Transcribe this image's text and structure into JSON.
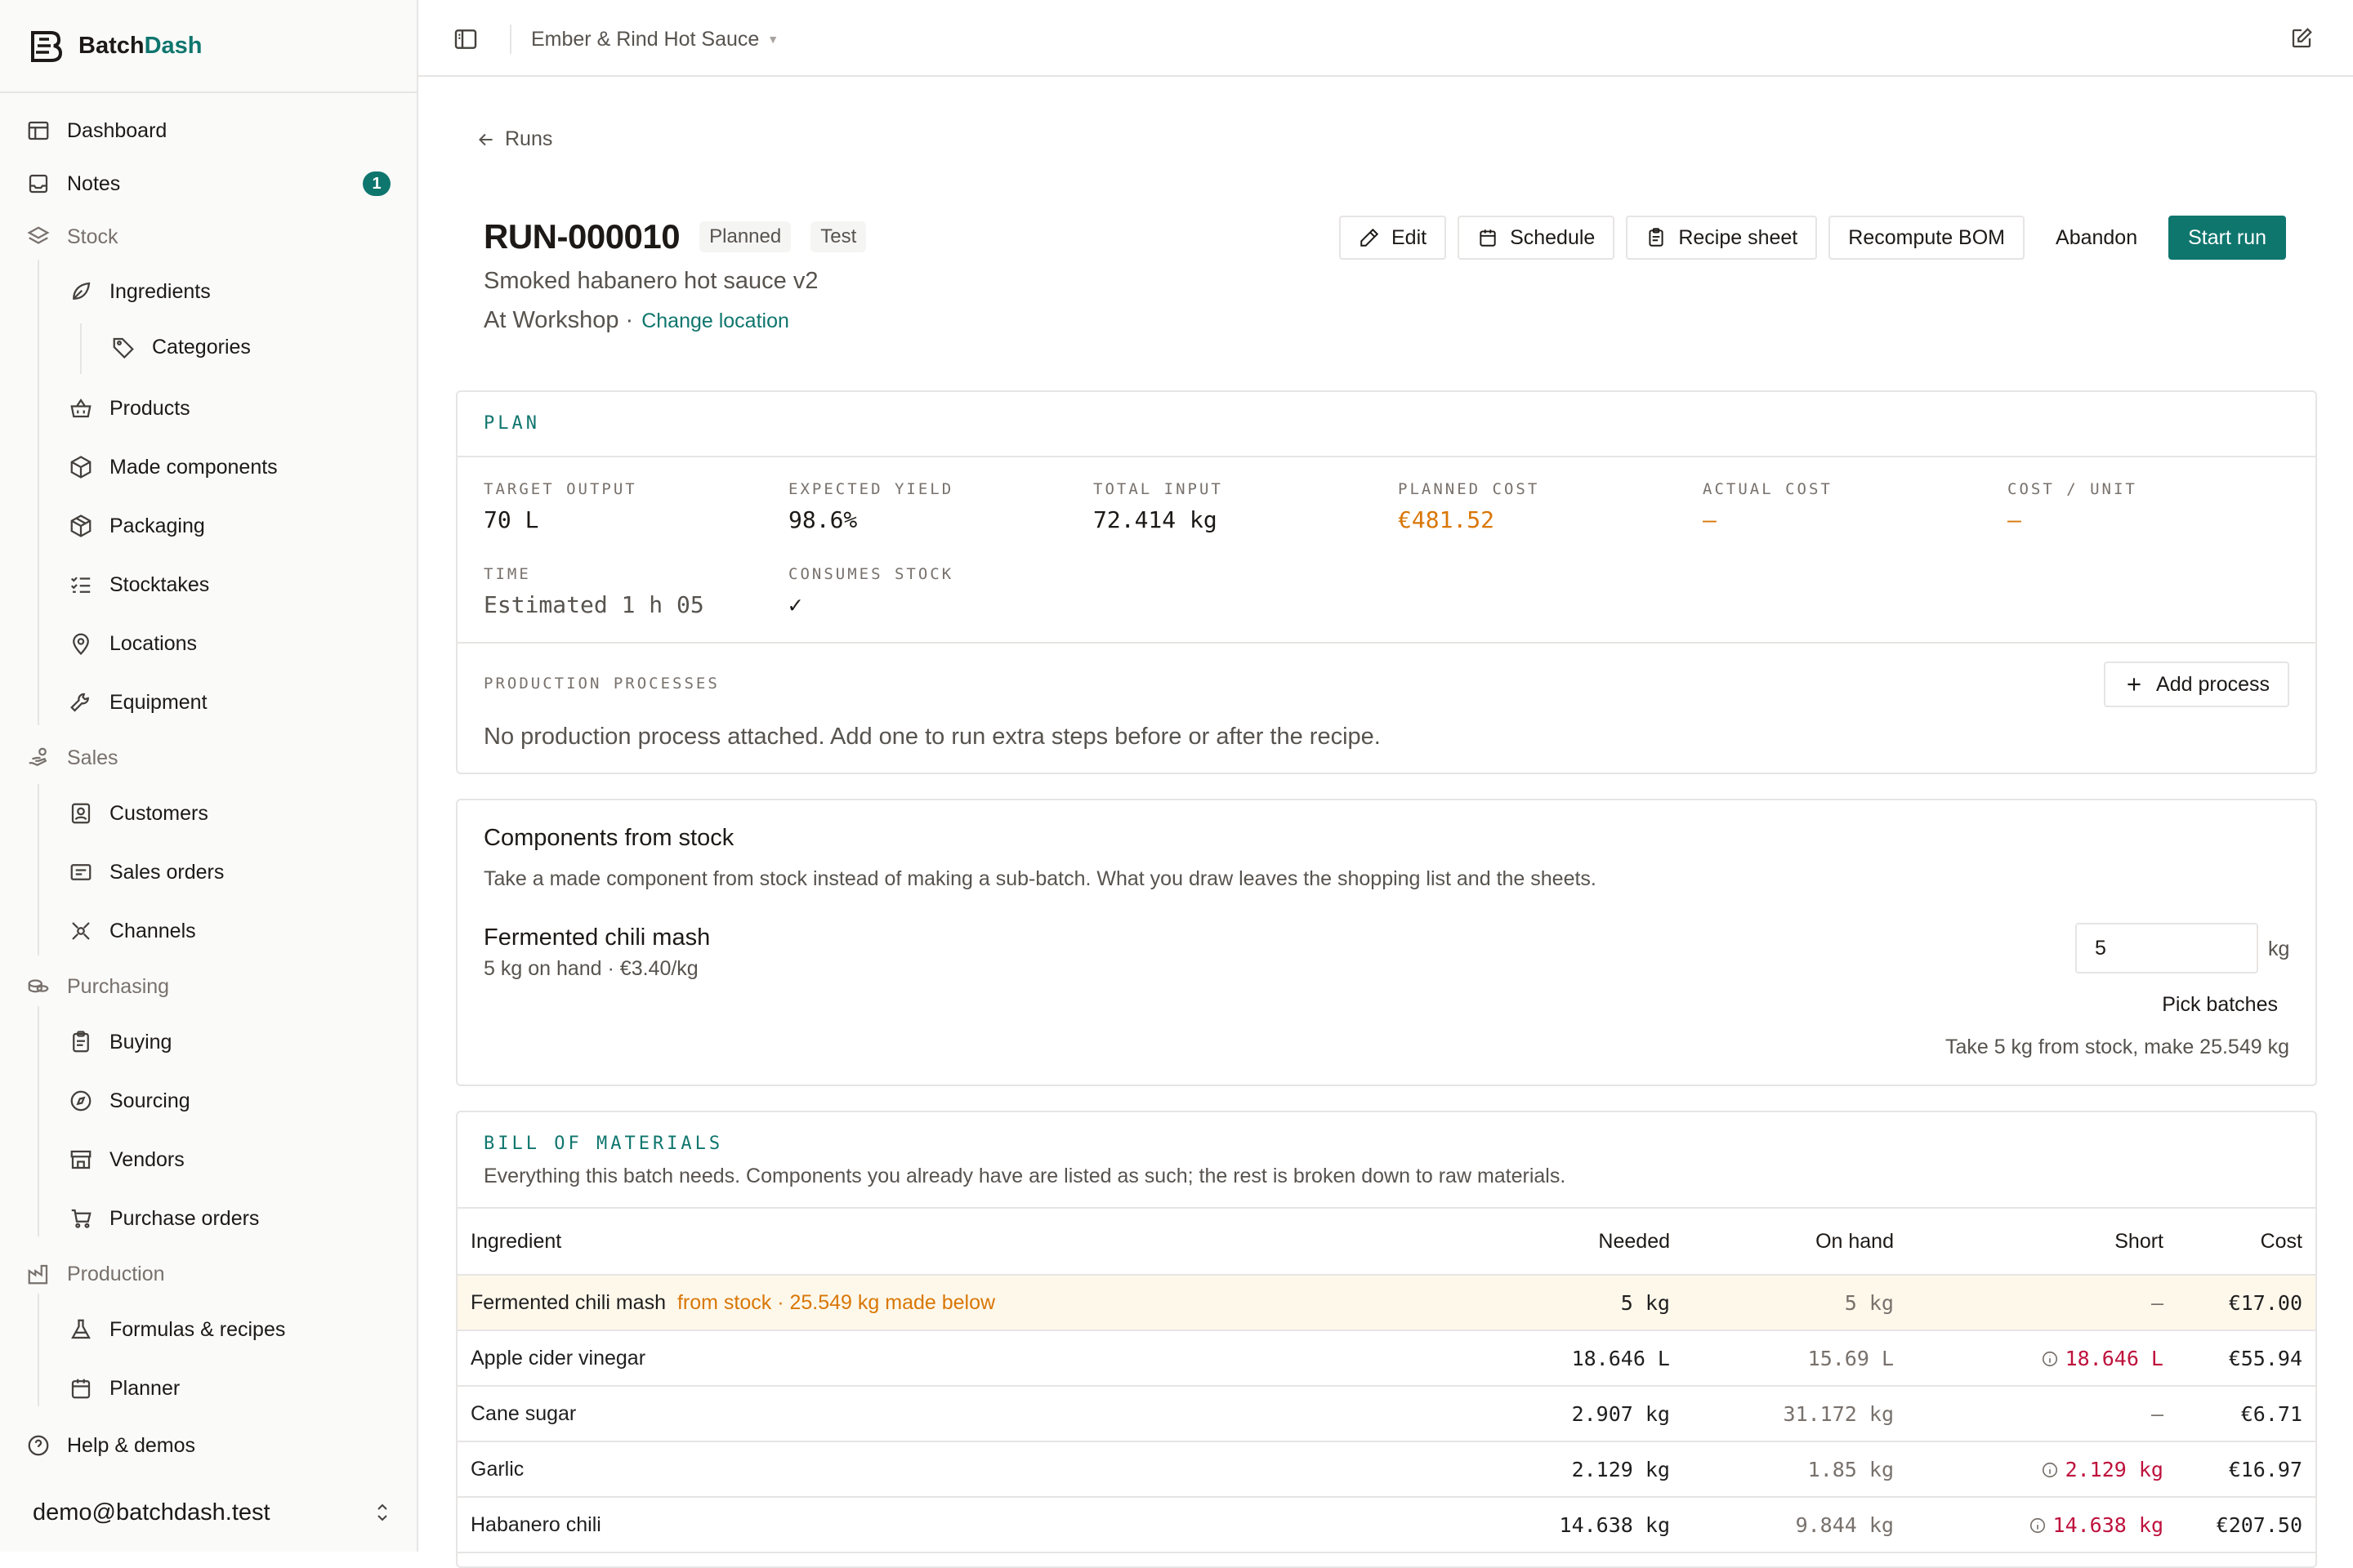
{
  "brand": {
    "name_part1": "Batch",
    "name_part2": "Dash"
  },
  "workspace": {
    "name": "Ember & Rind Hot Sauce"
  },
  "sidebar": {
    "items": [
      {
        "label": "Dashboard",
        "icon": "dashboard-icon"
      },
      {
        "label": "Notes",
        "icon": "inbox-icon",
        "badge": "1"
      },
      {
        "label": "Stock",
        "icon": "layers-icon",
        "group": true
      },
      {
        "label": "Ingredients",
        "icon": "leaf-icon"
      },
      {
        "label": "Categories",
        "icon": "tag-icon"
      },
      {
        "label": "Products",
        "icon": "basket-icon"
      },
      {
        "label": "Made components",
        "icon": "cube-icon"
      },
      {
        "label": "Packaging",
        "icon": "package-icon"
      },
      {
        "label": "Stocktakes",
        "icon": "checklist-icon"
      },
      {
        "label": "Locations",
        "icon": "map-pin-icon"
      },
      {
        "label": "Equipment",
        "icon": "wrench-icon"
      },
      {
        "label": "Sales",
        "icon": "hand-coins-icon",
        "group": true
      },
      {
        "label": "Customers",
        "icon": "contact-icon"
      },
      {
        "label": "Sales orders",
        "icon": "receipt-icon"
      },
      {
        "label": "Channels",
        "icon": "network-icon"
      },
      {
        "label": "Purchasing",
        "icon": "coins-icon",
        "group": true
      },
      {
        "label": "Buying",
        "icon": "clipboard-icon"
      },
      {
        "label": "Sourcing",
        "icon": "compass-icon"
      },
      {
        "label": "Vendors",
        "icon": "store-icon"
      },
      {
        "label": "Purchase orders",
        "icon": "cart-icon"
      },
      {
        "label": "Production",
        "icon": "factory-icon",
        "group": true
      },
      {
        "label": "Formulas & recipes",
        "icon": "flask-icon"
      },
      {
        "label": "Planner",
        "icon": "calendar-icon"
      },
      {
        "label": "Help & demos",
        "icon": "help-icon"
      }
    ],
    "account": "demo@batchdash.test"
  },
  "header": {
    "back_label": "Runs",
    "run_id": "RUN-000010",
    "status_pill": "Planned",
    "type_pill": "Test",
    "recipe_name": "Smoked habanero hot sauce v2",
    "location_text": "At Workshop ·",
    "change_location": "Change location",
    "actions": {
      "edit": "Edit",
      "schedule": "Schedule",
      "recipe_sheet": "Recipe sheet",
      "recompute": "Recompute BOM",
      "abandon": "Abandon",
      "start": "Start run"
    }
  },
  "plan": {
    "title": "PLAN",
    "stats": {
      "target_output": {
        "label": "TARGET OUTPUT",
        "value": "70 L"
      },
      "expected_yield": {
        "label": "EXPECTED YIELD",
        "value": "98.6%"
      },
      "total_input": {
        "label": "TOTAL INPUT",
        "value": "72.414 kg"
      },
      "planned_cost": {
        "label": "PLANNED COST",
        "value": "€481.52"
      },
      "actual_cost": {
        "label": "ACTUAL COST",
        "value": "—"
      },
      "cost_per_unit": {
        "label": "COST / UNIT",
        "value": "—"
      },
      "time": {
        "label": "TIME",
        "value": "Estimated 1 h 05"
      },
      "consumes_stock": {
        "label": "CONSUMES STOCK",
        "value": "✓"
      }
    },
    "processes_label": "PRODUCTION PROCESSES",
    "add_process": "Add process",
    "processes_empty": "No production process attached. Add one to run extra steps before or after the recipe."
  },
  "components": {
    "title": "Components from stock",
    "description": "Take a made component from stock instead of making a sub-batch. What you draw leaves the shopping list and the sheets.",
    "item_name": "Fermented chili mash",
    "item_detail": "5 kg on hand · €3.40/kg",
    "qty_value": "5",
    "qty_unit": "kg",
    "pick_batches": "Pick batches",
    "summary": "Take 5 kg from stock, make 25.549 kg"
  },
  "bom": {
    "title": "BILL OF MATERIALS",
    "description": "Everything this batch needs. Components you already have are listed as such; the rest is broken down to raw materials.",
    "columns": {
      "ingredient": "Ingredient",
      "needed": "Needed",
      "on_hand": "On hand",
      "short": "Short",
      "cost": "Cost"
    },
    "rows": [
      {
        "ingredient": "Fermented chili mash",
        "note": "from stock · 25.549 kg made below",
        "needed": "5 kg",
        "on_hand": "5 kg",
        "short": "—",
        "cost": "€17.00"
      },
      {
        "ingredient": "Apple cider vinegar",
        "needed": "18.646 L",
        "on_hand": "15.69 L",
        "short": "18.646 L",
        "cost": "€55.94"
      },
      {
        "ingredient": "Cane sugar",
        "needed": "2.907 kg",
        "on_hand": "31.172 kg",
        "short": "—",
        "cost": "€6.71"
      },
      {
        "ingredient": "Garlic",
        "needed": "2.129 kg",
        "on_hand": "1.85 kg",
        "short": "2.129 kg",
        "cost": "€16.97"
      },
      {
        "ingredient": "Habanero chili",
        "needed": "14.638 kg",
        "on_hand": "9.844 kg",
        "short": "14.638 kg",
        "cost": "€207.50"
      }
    ]
  },
  "colors": {
    "accent": "#0f766e",
    "warning": "#d97706",
    "danger": "#be123c"
  }
}
